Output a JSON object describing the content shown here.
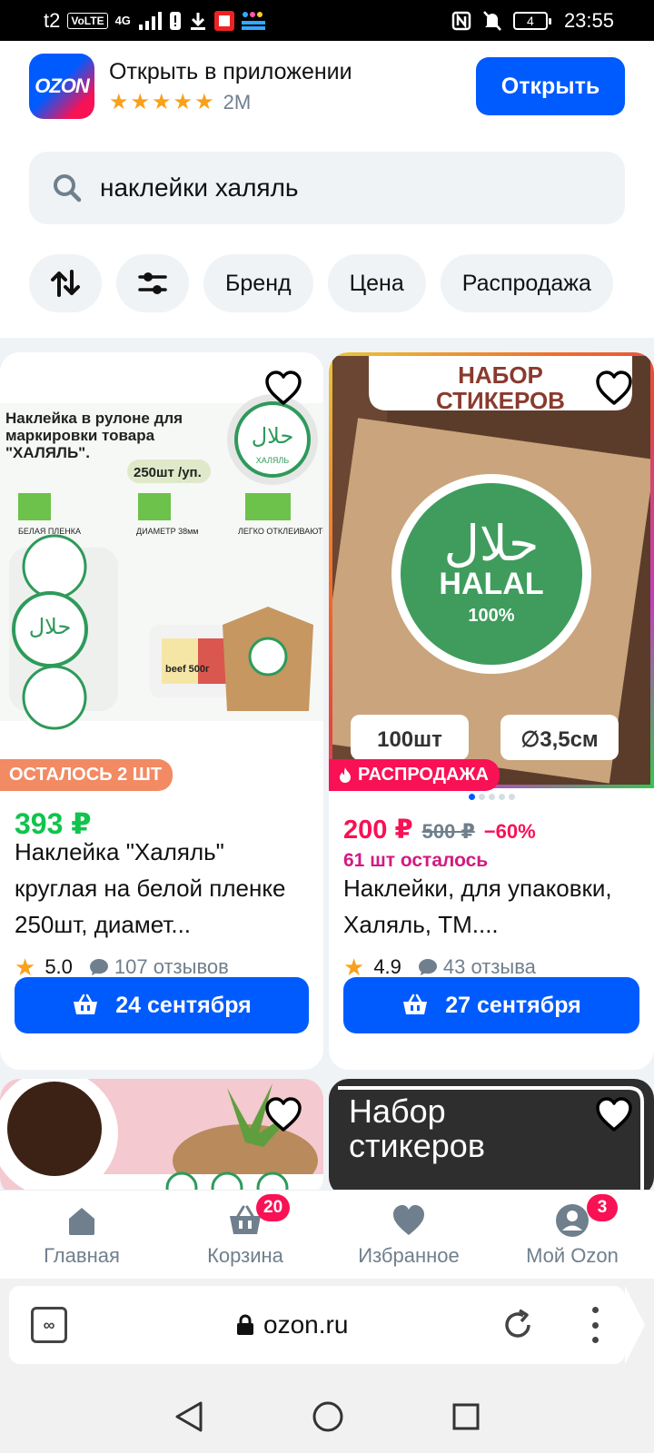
{
  "status_bar": {
    "carrier": "t2",
    "volte": "VoLTE",
    "network": "4G",
    "battery": "4",
    "time": "23:55"
  },
  "app_banner": {
    "logo_text": "OZON",
    "title": "Открыть в приложении",
    "stars": 5,
    "rating_count": "2M",
    "open_button": "Открыть",
    "accent_color": "#005bff"
  },
  "search": {
    "query": "наклейки халяль",
    "icon": "search-icon"
  },
  "filters": {
    "sort_icon": "sort-icon",
    "settings_icon": "filter-settings-icon",
    "chips": [
      "Бренд",
      "Цена",
      "Распродажа"
    ]
  },
  "products": [
    {
      "image_text": {
        "heading": "Наклейка в рулоне для маркировки товара \"ХАЛЯЛЬ\".",
        "pack": "250шт /уп.",
        "feature_1": "БЕЛАЯ ПЛЕНКА",
        "feature_2": "ДИАМЕТР 38мм",
        "feature_3": "ЛЕГКО ОТКЛЕИВАЮТСЯ",
        "label": "ХАЛЯЛЬ",
        "tray": "beef 500г"
      },
      "badge": "ОСТАЛОСЬ 2 ШТ",
      "price": "393 ₽",
      "title": "Наклейка \"Халяль\" круглая на белой пленке 250шт, диамет...",
      "rating": "5.0",
      "reviews": "107 отзывов",
      "delivery": "24 сентября"
    },
    {
      "image_text": {
        "heading": "НАБОР СТИКЕРОВ",
        "halal": "HALAL",
        "percent": "100%",
        "count": "100шт",
        "size": "∅3,5см"
      },
      "badge": "РАСПРОДАЖА",
      "price": "200 ₽",
      "old_price": "500 ₽",
      "discount": "−60%",
      "stock": "61 шт осталось",
      "title": "Наклейки, для упаковки, Халяль, ТМ....",
      "rating": "4.9",
      "reviews": "43 отзыва",
      "delivery": "27 сентября"
    },
    {
      "image_text": {}
    },
    {
      "image_text": {
        "heading": "Набор стикеров"
      }
    }
  ],
  "bottom_nav": [
    {
      "label": "Главная",
      "icon": "home-icon"
    },
    {
      "label": "Корзина",
      "icon": "cart-icon",
      "badge": "20"
    },
    {
      "label": "Избранное",
      "icon": "heart-icon"
    },
    {
      "label": "Мой Ozon",
      "icon": "profile-icon",
      "badge": "3"
    }
  ],
  "browser": {
    "tab_count": "∞",
    "url": "ozon.ru"
  }
}
